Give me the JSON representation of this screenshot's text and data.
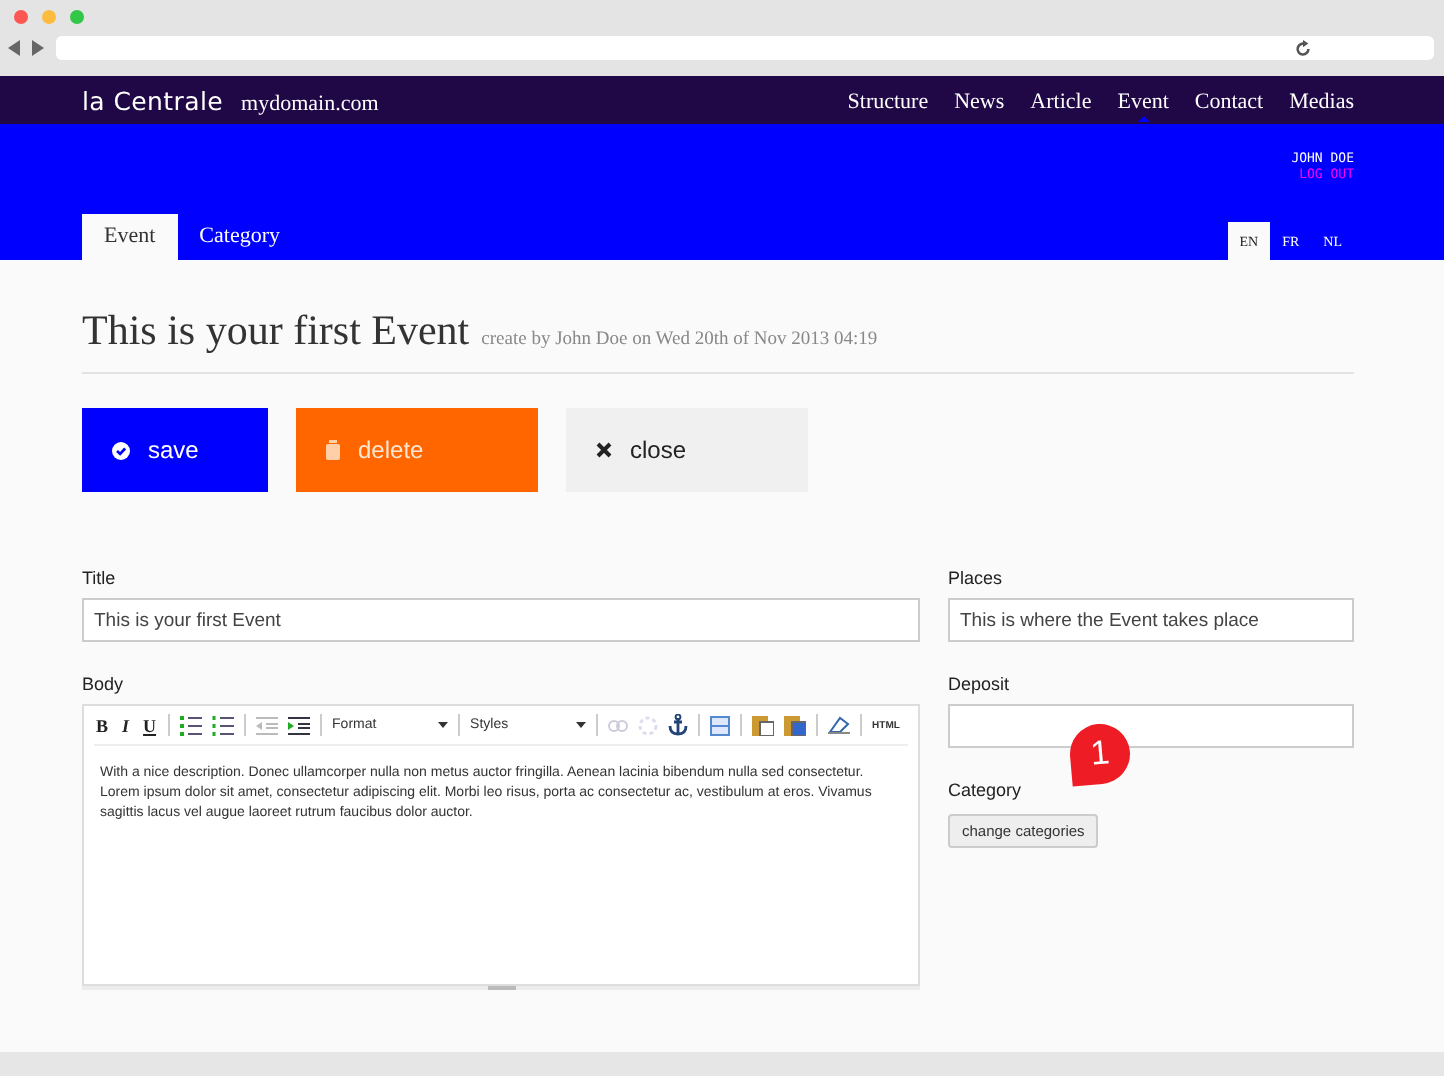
{
  "site": {
    "logo": "la Centrale",
    "domain": "mydomain.com"
  },
  "nav": [
    {
      "label": "Structure",
      "selected": false
    },
    {
      "label": "News",
      "selected": false
    },
    {
      "label": "Article",
      "selected": false
    },
    {
      "label": "Event",
      "selected": true
    },
    {
      "label": "Contact",
      "selected": false
    },
    {
      "label": "Medias",
      "selected": false
    }
  ],
  "user": {
    "name": "JOHN DOE",
    "logout": "LOG OUT"
  },
  "tabs": [
    {
      "label": "Event",
      "selected": true
    },
    {
      "label": "Category",
      "selected": false
    }
  ],
  "languages": [
    {
      "label": "EN",
      "selected": true
    },
    {
      "label": "FR",
      "selected": false
    },
    {
      "label": "NL",
      "selected": false
    }
  ],
  "heading": {
    "title": "This is your first Event",
    "meta": "create by John Doe on Wed 20th of Nov 2013 04:19"
  },
  "actions": [
    {
      "kind": "save",
      "label": "save"
    },
    {
      "kind": "delete",
      "label": "delete"
    },
    {
      "kind": "close",
      "label": "close"
    }
  ],
  "form": {
    "title": {
      "label": "Title",
      "value": "This is your first Event"
    },
    "body": {
      "label": "Body",
      "toolbar": {
        "bold": "B",
        "italic": "I",
        "underline": "U",
        "format": "Format",
        "styles": "Styles",
        "html": "HTML"
      },
      "text": "With a nice description. Donec ullamcorper nulla non metus auctor fringilla. Aenean lacinia bibendum nulla sed consectetur. Lorem ipsum dolor sit amet, consectetur adipiscing elit. Morbi leo risus, porta ac consectetur ac, vestibulum at eros. Vivamus sagittis lacus vel augue laoreet rutrum faucibus dolor auctor."
    },
    "places": {
      "label": "Places",
      "value": "This is where the Event takes place"
    },
    "deposit": {
      "label": "Deposit"
    },
    "category": {
      "label": "Category",
      "button": "change categories"
    }
  },
  "marker": {
    "label": "1"
  }
}
